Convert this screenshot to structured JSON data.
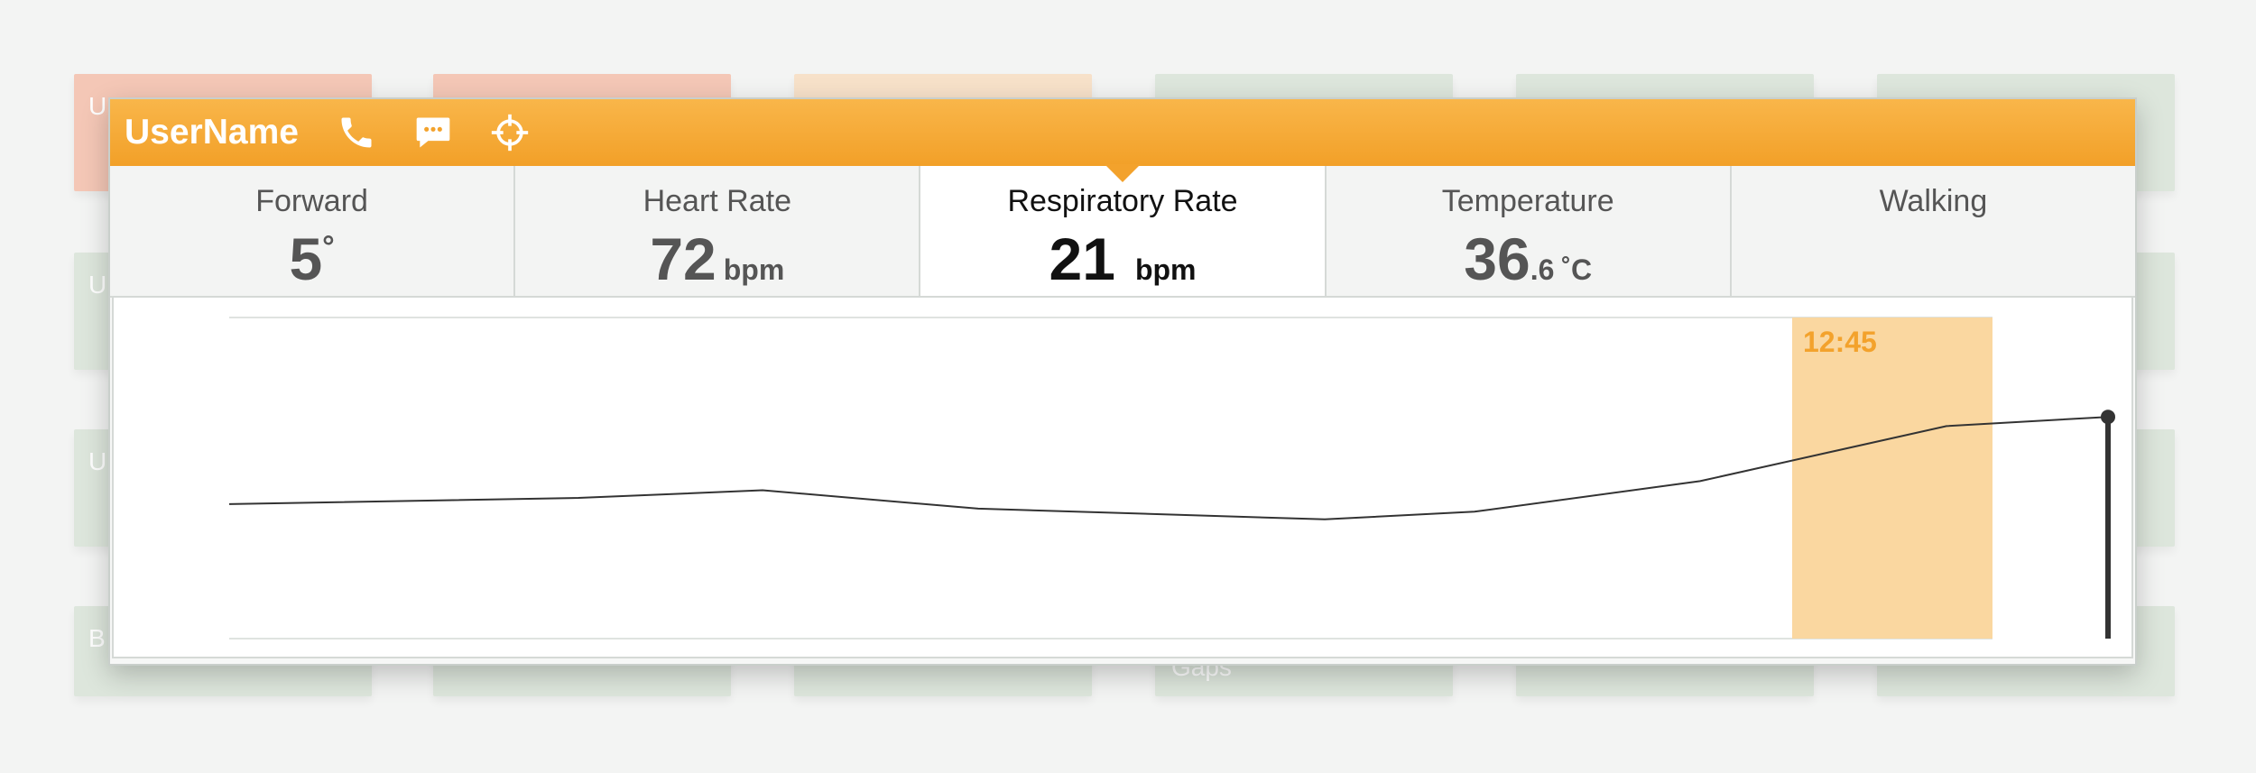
{
  "popup": {
    "username": "UserName",
    "icons": [
      "phone-icon",
      "chat-icon",
      "locate-icon"
    ],
    "header_color": "#f2a028",
    "tabs": [
      {
        "label": "Forward",
        "value": "5",
        "unit": "°"
      },
      {
        "label": "Heart Rate",
        "value": "72",
        "unit": "bpm"
      },
      {
        "label": "Respiratory Rate",
        "value": "21",
        "unit": "bpm",
        "active": true
      },
      {
        "label": "Temperature",
        "value": "36",
        "decimal": ".6",
        "unit": "˚C"
      },
      {
        "label": "Walking"
      }
    ]
  },
  "background": {
    "visible_text": [
      "U",
      "U",
      "U",
      "B",
      "Gaps"
    ]
  },
  "chart_data": {
    "type": "line",
    "title": "",
    "xlabel": "",
    "ylabel": "",
    "series": [
      {
        "values": [
          18.4,
          18.6,
          18.85,
          18.25,
          17.9,
          18.15,
          19.15,
          20.95,
          21.25
        ]
      }
    ],
    "ylim": [
      14,
      24.5
    ],
    "highlight": {
      "label": "12:45",
      "color": "#fad7a0",
      "text_color": "#f3a22c"
    },
    "current_point_index": 8,
    "grid": false
  }
}
